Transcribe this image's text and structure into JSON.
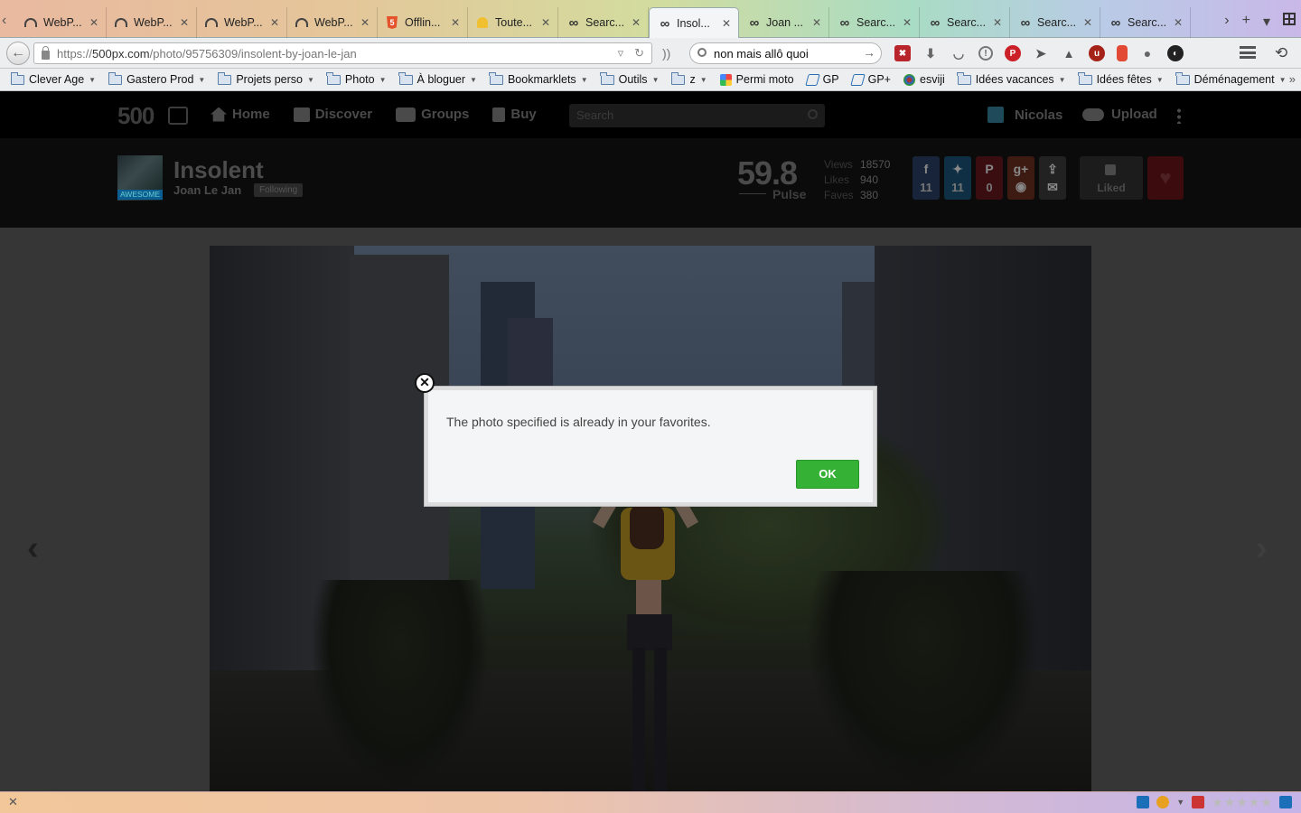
{
  "browser": {
    "tabs": [
      {
        "label": "WebP...",
        "icon": "speedometer-icon",
        "active": false
      },
      {
        "label": "WebP...",
        "icon": "speedometer-icon",
        "active": false
      },
      {
        "label": "WebP...",
        "icon": "speedometer-icon",
        "active": false
      },
      {
        "label": "WebP...",
        "icon": "speedometer-icon",
        "active": false
      },
      {
        "label": "Offlin...",
        "icon": "html5-icon",
        "active": false
      },
      {
        "label": "Toute...",
        "icon": "bell-icon",
        "active": false
      },
      {
        "label": "Searc...",
        "icon": "infinity-icon",
        "active": false
      },
      {
        "label": "Insol...",
        "icon": "infinity-icon",
        "active": true
      },
      {
        "label": "Joan ...",
        "icon": "infinity-icon",
        "active": false
      },
      {
        "label": "Searc...",
        "icon": "infinity-icon",
        "active": false
      },
      {
        "label": "Searc...",
        "icon": "infinity-icon",
        "active": false
      },
      {
        "label": "Searc...",
        "icon": "infinity-icon",
        "active": false
      },
      {
        "label": "Searc...",
        "icon": "infinity-icon",
        "active": false
      }
    ],
    "url_prefix": "https://",
    "url_domain": "500px.com",
    "url_path": "/photo/95756309/insolent-by-joan-le-jan",
    "search_value": "non mais allô quoi",
    "bookmarks": [
      {
        "label": "Clever Age",
        "type": "folder",
        "dropdown": true
      },
      {
        "label": "Gastero Prod",
        "type": "folder",
        "dropdown": true
      },
      {
        "label": "Projets perso",
        "type": "folder",
        "dropdown": true
      },
      {
        "label": "Photo",
        "type": "folder",
        "dropdown": true
      },
      {
        "label": "À bloguer",
        "type": "folder",
        "dropdown": true
      },
      {
        "label": "Bookmarklets",
        "type": "folder",
        "dropdown": true
      },
      {
        "label": "Outils",
        "type": "folder",
        "dropdown": true
      },
      {
        "label": "z",
        "type": "folder",
        "dropdown": true
      },
      {
        "label": "Permi moto",
        "type": "link",
        "dropdown": false
      },
      {
        "label": "GP",
        "type": "link",
        "dropdown": false
      },
      {
        "label": "GP+",
        "type": "link",
        "dropdown": false
      },
      {
        "label": "esviji",
        "type": "link",
        "dropdown": false
      },
      {
        "label": "Idées vacances",
        "type": "folder",
        "dropdown": true
      },
      {
        "label": "Idées fêtes",
        "type": "folder",
        "dropdown": true
      },
      {
        "label": "Déménagement",
        "type": "folder",
        "dropdown": true
      }
    ]
  },
  "site": {
    "logo": "500",
    "nav": [
      {
        "label": "Home",
        "icon": "home-icon"
      },
      {
        "label": "Discover",
        "icon": "discover-icon"
      },
      {
        "label": "Groups",
        "icon": "groups-icon"
      },
      {
        "label": "Buy",
        "icon": "buy-icon"
      }
    ],
    "search_placeholder": "Search",
    "user_name": "Nicolas",
    "upload_label": "Upload"
  },
  "photo": {
    "title": "Insolent",
    "author": "Joan Le Jan",
    "author_badge": "AWESOME",
    "follow_status": "Following",
    "pulse_value": "59.8",
    "pulse_label": "Pulse",
    "stats": [
      {
        "label": "Views",
        "value": "18570"
      },
      {
        "label": "Likes",
        "value": "940"
      },
      {
        "label": "Faves",
        "value": "380"
      }
    ],
    "share": {
      "facebook_count": "11",
      "twitter_count": "11",
      "pinterest_count": "0"
    },
    "liked_label": "Liked"
  },
  "modal": {
    "message": "The photo specified is already in your favorites.",
    "ok_label": "OK"
  }
}
